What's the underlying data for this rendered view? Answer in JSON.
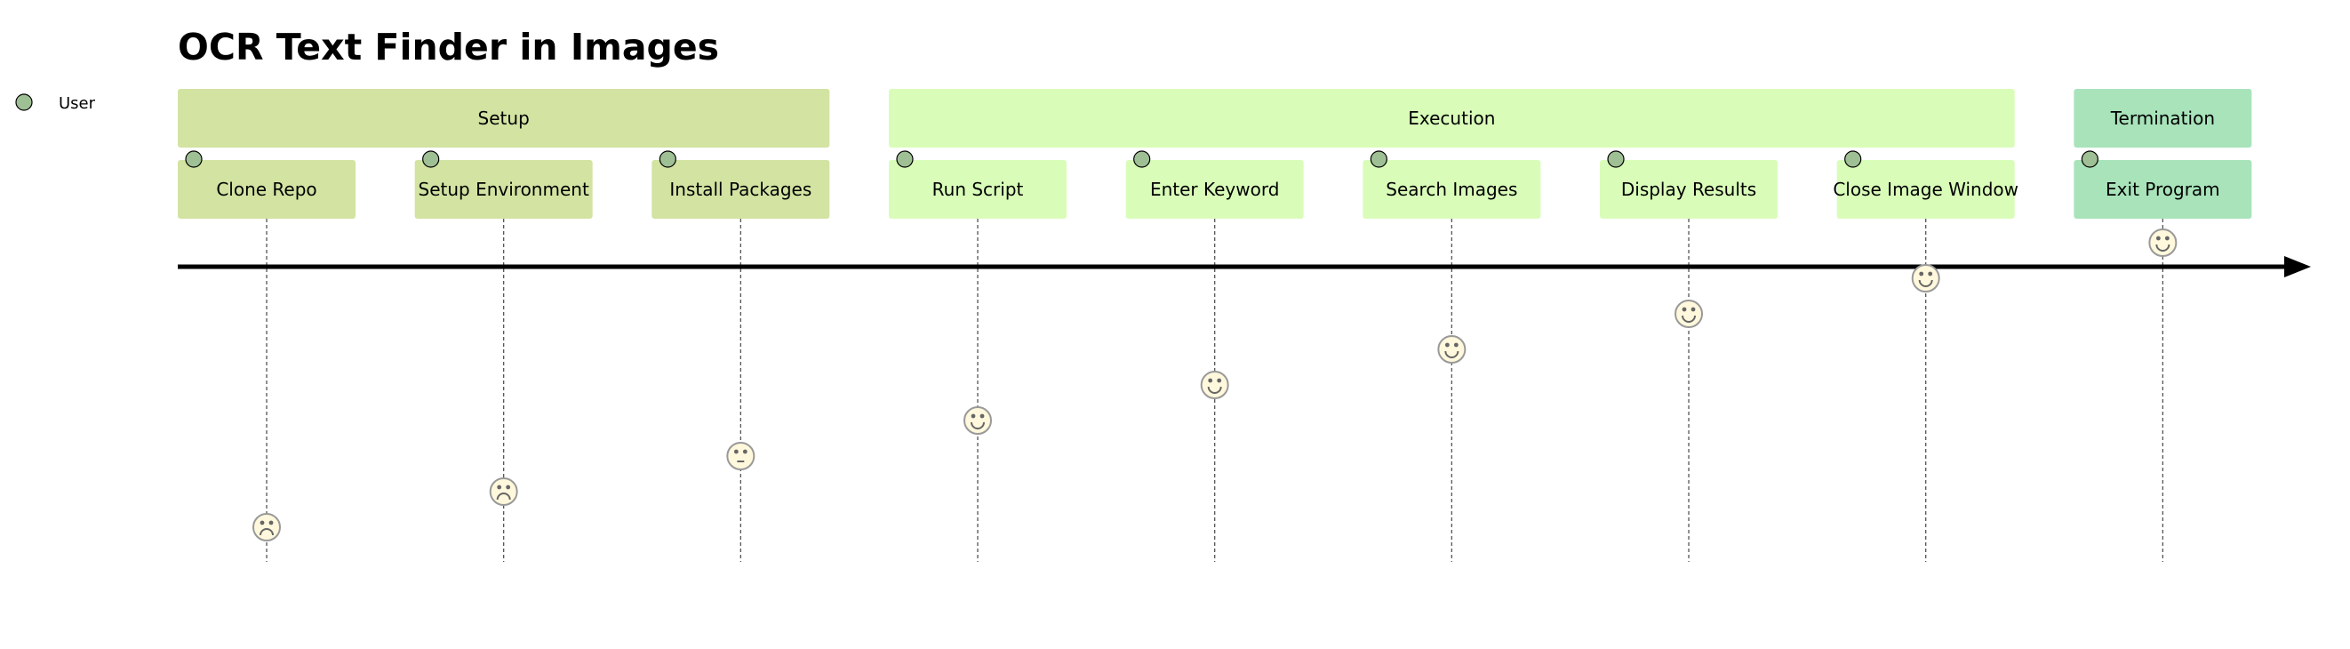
{
  "title": "OCR Text Finder in Images",
  "legend": [
    {
      "actor": "User",
      "color": "#9fbf94"
    }
  ],
  "sections": [
    {
      "name": "Setup",
      "color": "#d2e3a2",
      "tasks": [
        {
          "label": "Clone Repo",
          "score": 1,
          "actors": [
            "User"
          ]
        },
        {
          "label": "Setup Environment",
          "score": 2,
          "actors": [
            "User"
          ]
        },
        {
          "label": "Install Packages",
          "score": 3,
          "actors": [
            "User"
          ]
        }
      ]
    },
    {
      "name": "Execution",
      "color": "#d9fdb9",
      "tasks": [
        {
          "label": "Run Script",
          "score": 4,
          "actors": [
            "User"
          ]
        },
        {
          "label": "Enter Keyword",
          "score": 5,
          "actors": [
            "User"
          ]
        },
        {
          "label": "Search Images",
          "score": 6,
          "actors": [
            "User"
          ]
        },
        {
          "label": "Display Results",
          "score": 7,
          "actors": [
            "User"
          ]
        },
        {
          "label": "Close Image Window",
          "score": 8,
          "actors": [
            "User"
          ]
        }
      ]
    },
    {
      "name": "Termination",
      "color": "#a8e3ba",
      "tasks": [
        {
          "label": "Exit Program",
          "score": 9,
          "actors": [
            "User"
          ]
        }
      ]
    }
  ],
  "face_rules": {
    "sad_below": 3,
    "neutral_at": 3,
    "happy_above": 3
  },
  "colors": {
    "face_fill": "#FFF8DC",
    "face_stroke": "#999999",
    "axis": "#000000"
  }
}
